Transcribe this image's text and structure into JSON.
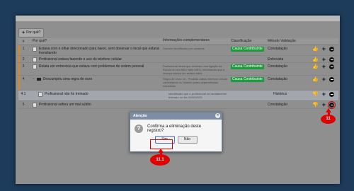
{
  "toolbar": {
    "add_why_label": "Por quê?"
  },
  "table": {
    "headers": {
      "num": "#",
      "why": "Por quê?",
      "info": "Informações complementares",
      "class": "Classificação",
      "method": "Método Validação"
    },
    "rows": [
      {
        "num": "1",
        "why": "Estava com o olhar direcionado para baixo, sem observar o local que estava transitando",
        "info": "Cenário identificado por câmeras",
        "class": "Causa Contribuinte",
        "method": "Constatação"
      },
      {
        "num": "2",
        "why": "Profissional estava fazendo o uso do telefone celular",
        "info": "",
        "class": "",
        "method": "Entrevista"
      },
      {
        "num": "3",
        "why": "Relata em entrevista que estava com problemas de ordem pessoal",
        "info": "Profissional relata que recebeu uma ligação da Escola do seu filho mais velho, informando que a criança estava em estado febril",
        "class": "Causa Contribuinte",
        "method": "Constatação"
      },
      {
        "num": "4",
        "why": "Descumpriu uma regra de ouro",
        "info": "Regra de Ouro 10 - Proibido utilizar telefone celular caminhando ou falando pelas dependências industriais",
        "class": "Causa Contribuinte",
        "method": "Constatação"
      },
      {
        "num": "4.1",
        "why": "Profissional não foi treinado",
        "info": "Identificado que o profissional foi devidamente treinado no dia 01/06/2025",
        "class": "",
        "method": "Histórico"
      },
      {
        "num": "5",
        "why": "Profissional sofreu um mal súbito",
        "info": "",
        "class": "",
        "method": "Constatação"
      }
    ]
  },
  "dialog": {
    "title": "Atenção",
    "message": "Confirma a eliminação deste registro?",
    "yes_label": "Sim",
    "no_label": "Não"
  },
  "annotations": {
    "step_remove": "11",
    "step_confirm": "11.1"
  },
  "colors": {
    "accent_orange": "#d98a1f",
    "badge_green": "#1e9a3e",
    "annotation_red": "#e00000"
  }
}
